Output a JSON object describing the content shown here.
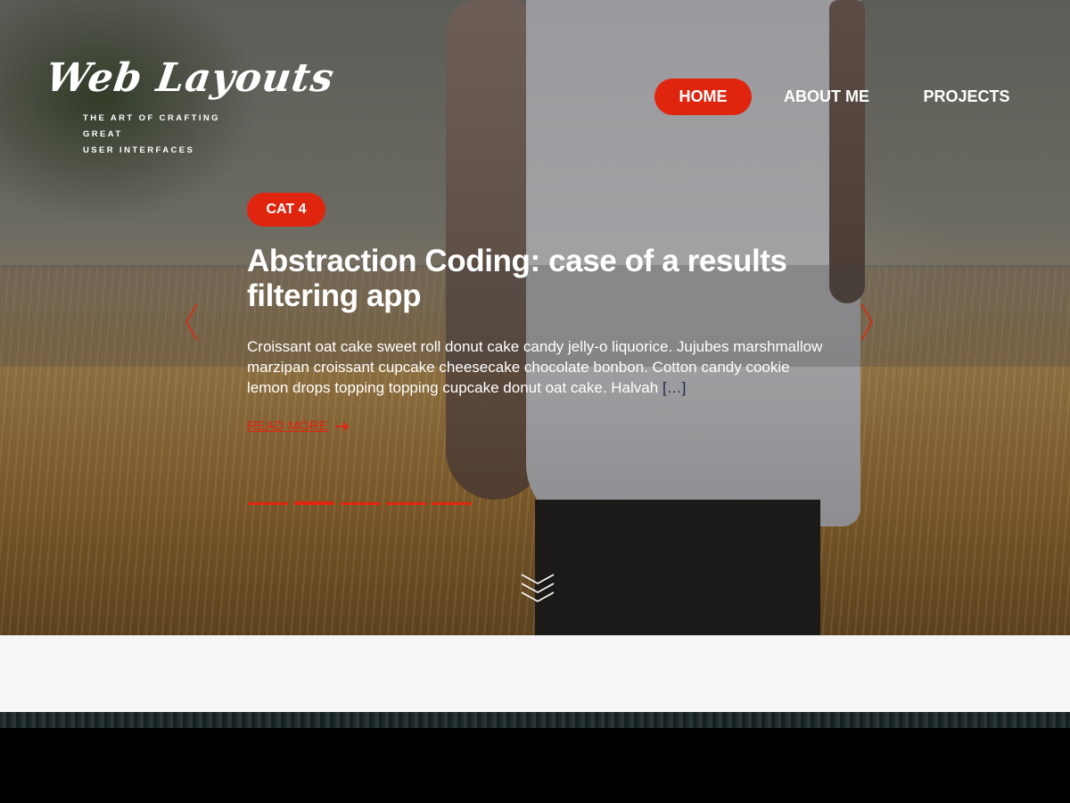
{
  "logo": {
    "title": "Web Layouts",
    "tagline_line1": "THE ART OF CRAFTING GREAT",
    "tagline_line2": "USER INTERFACES"
  },
  "nav": {
    "items": [
      {
        "label": "HOME",
        "active": true
      },
      {
        "label": "ABOUT ME",
        "active": false
      },
      {
        "label": "PROJECTS",
        "active": false
      }
    ]
  },
  "article": {
    "category": "CAT 4",
    "title": "Abstraction Coding: case of a results filtering app",
    "excerpt": "Croissant oat cake sweet roll donut cake candy jelly-o liquorice. Jujubes marshmallow marzipan croissant cupcake cheesecake chocolate bonbon. Cotton candy cookie lemon drops topping topping cupcake donut oat cake. Halvah",
    "excerpt_more": "[…]",
    "read_more": "READ MORE"
  },
  "slider": {
    "slide_count": 5,
    "active_index": 1
  },
  "icons": {
    "prev": "chevron-left-icon",
    "next": "chevron-right-icon",
    "scroll": "triple-chevron-down-icon",
    "read_more_arrow": "arrow-right-icon"
  },
  "colors": {
    "accent": "#e0250f",
    "light_section": "#f7f7f9",
    "ellipsis": "#1d2a44"
  }
}
